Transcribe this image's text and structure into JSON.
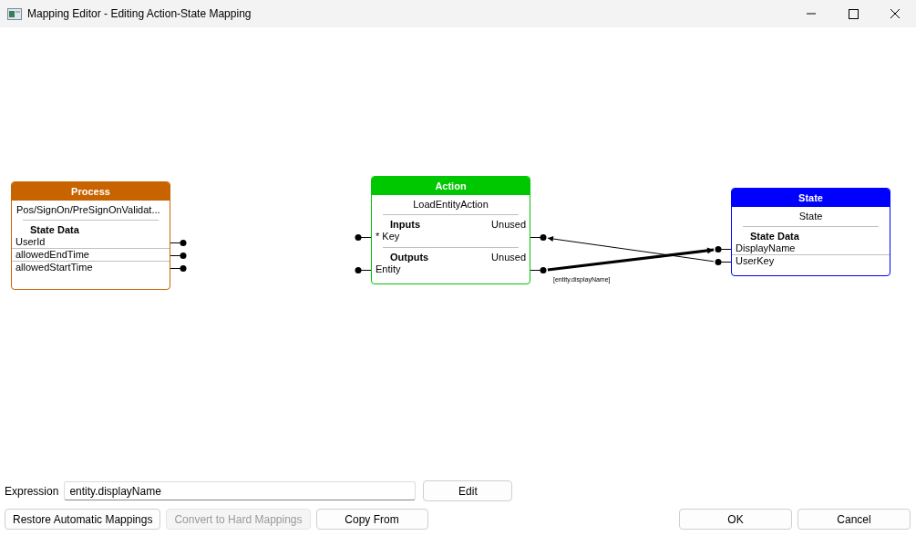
{
  "window": {
    "title": "Mapping Editor - Editing Action-State Mapping"
  },
  "nodes": [
    {
      "kind": "process",
      "title": "Process",
      "subtitle": "Pos/SignOn/PreSignOnValidat...",
      "sections": [
        {
          "heading": "State Data",
          "fields": [
            "UserId",
            "allowedEndTime",
            "allowedStartTime"
          ]
        }
      ]
    },
    {
      "kind": "action",
      "title": "Action",
      "subtitle": "LoadEntityAction",
      "sections": [
        {
          "heading": "Inputs",
          "status": "Unused",
          "fields": [
            "* Key"
          ]
        },
        {
          "heading": "Outputs",
          "status": "Unused",
          "fields": [
            "Entity"
          ]
        }
      ]
    },
    {
      "kind": "state",
      "title": "State",
      "subtitle": "State",
      "sections": [
        {
          "heading": "State Data",
          "fields": [
            "DisplayName",
            "UserKey"
          ]
        }
      ]
    }
  ],
  "connections": [
    {
      "label": "[entity.displayName]",
      "selected": true
    },
    {
      "selected": false
    }
  ],
  "expression": {
    "label": "Expression",
    "value": "entity.displayName",
    "button": "Edit"
  },
  "buttons": [
    {
      "label": "Restore Automatic Mappings",
      "disabled": false
    },
    {
      "label": "Convert to Hard Mappings",
      "disabled": true
    },
    {
      "label": "Copy From",
      "disabled": false
    }
  ],
  "dialog_buttons": [
    "OK",
    "Cancel"
  ]
}
